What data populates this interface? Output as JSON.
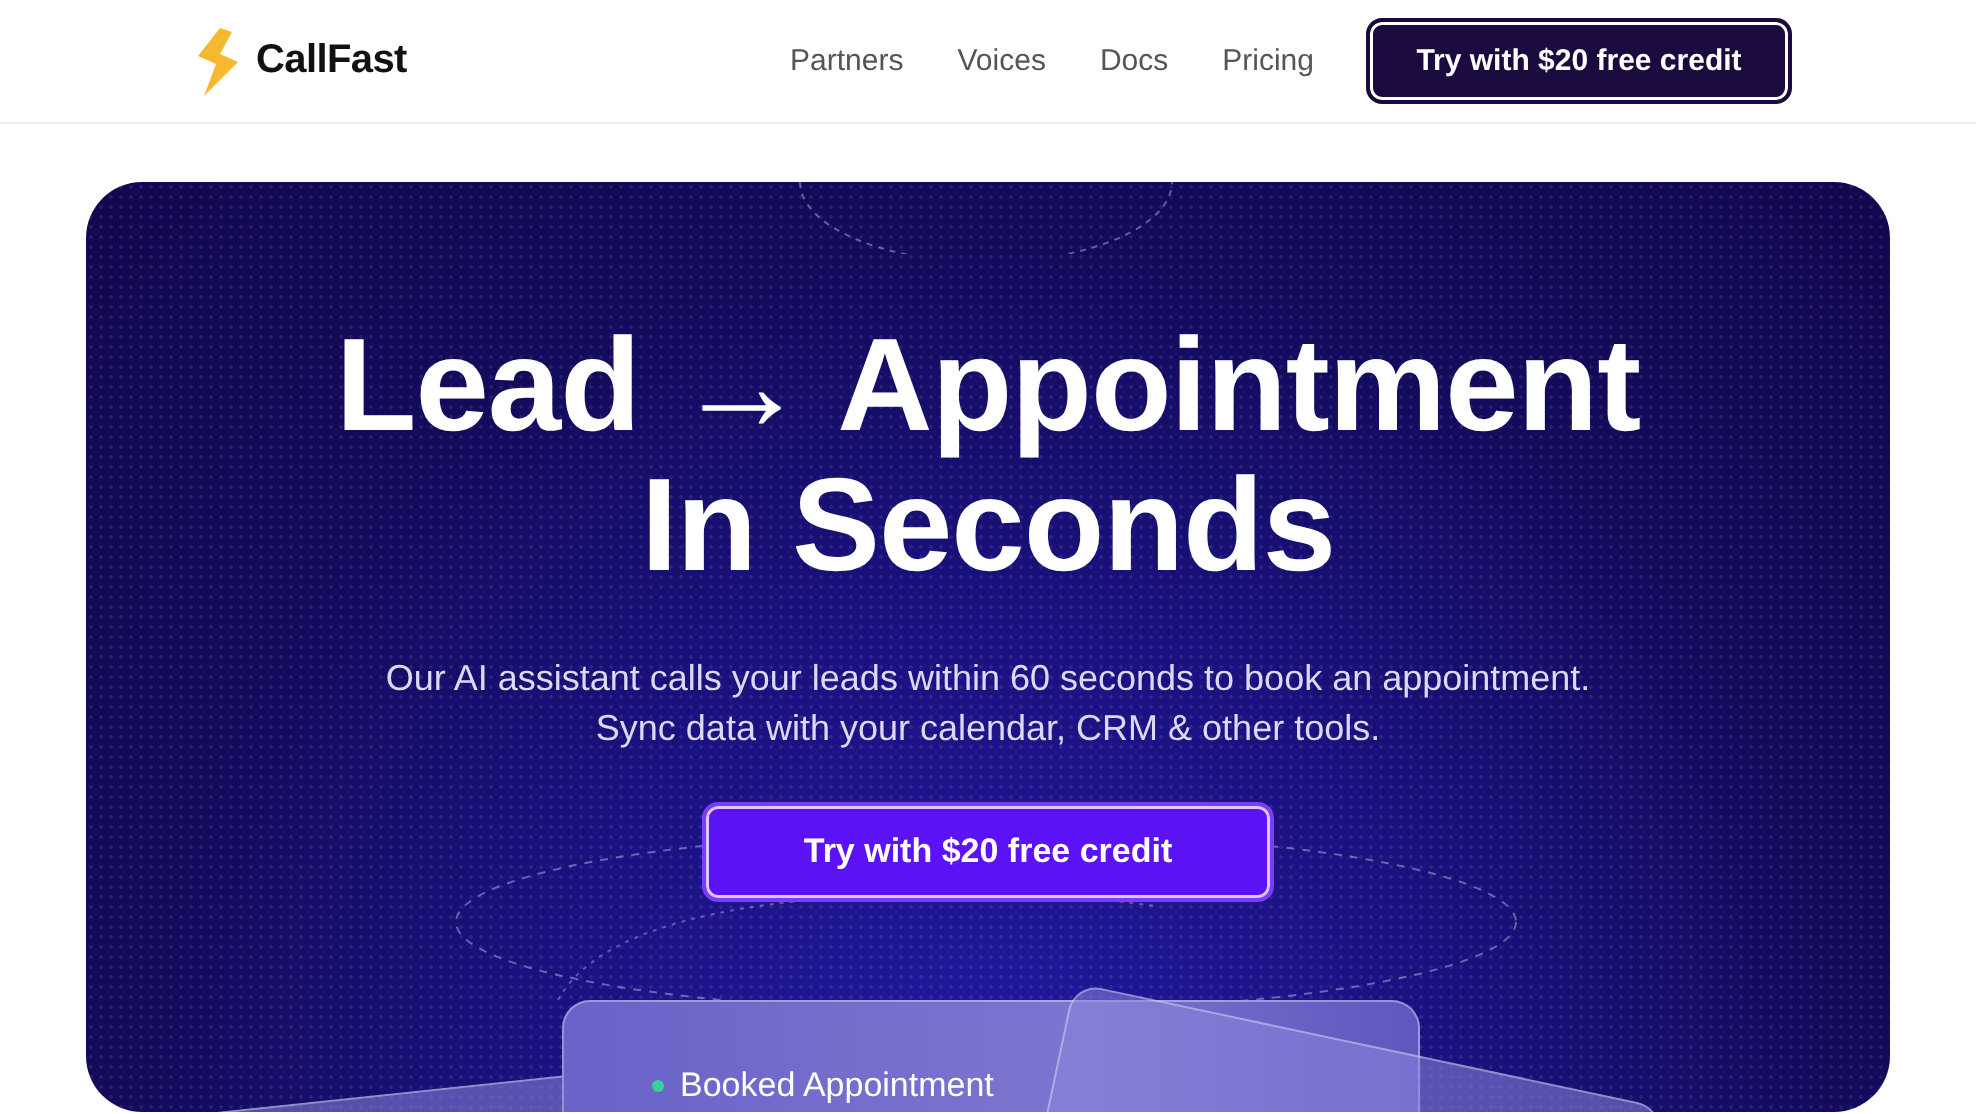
{
  "header": {
    "brand": "CallFast",
    "nav": [
      {
        "label": "Partners"
      },
      {
        "label": "Voices"
      },
      {
        "label": "Docs"
      },
      {
        "label": "Pricing"
      }
    ],
    "cta": "Try with $20 free credit"
  },
  "hero": {
    "title_line_1": "Lead → Appointment",
    "title_line_2": "In Seconds",
    "subtitle_line_1": "Our AI assistant calls your leads within 60 seconds to book an appointment.",
    "subtitle_line_2": "Sync data with your calendar, CRM & other tools.",
    "cta": "Try with $20 free credit",
    "card": {
      "label": "Booked Appointment",
      "color": "#34d399"
    }
  }
}
